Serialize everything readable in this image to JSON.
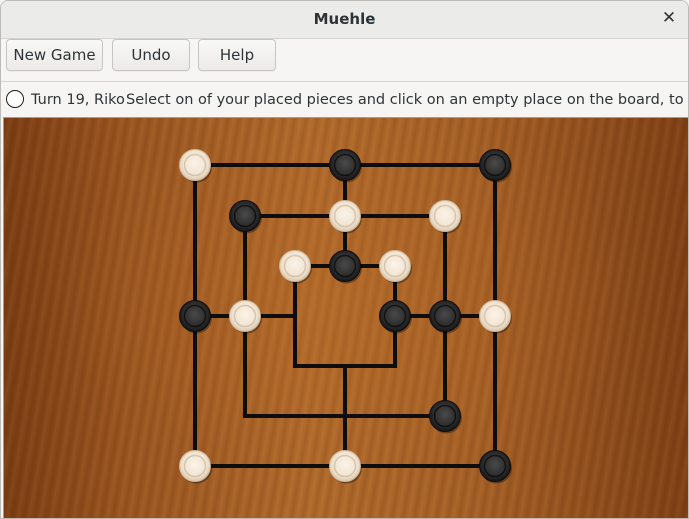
{
  "window": {
    "title": "Muehle",
    "close_icon": "close-icon"
  },
  "toolbar": {
    "new_game_label": "New Game",
    "undo_label": "Undo",
    "help_label": "Help"
  },
  "status": {
    "turn": "Turn 19, Riko",
    "message": "Select on of your placed pieces and click on an empty place on the board, to move it t",
    "indicator_color": "#ffffff"
  },
  "board": {
    "line_color": "#0d0d0d",
    "white_piece_color": "#f1e4d2",
    "black_piece_color": "#2b2b2b",
    "pieces": [
      {
        "point": "outer-top-left",
        "color": "white"
      },
      {
        "point": "outer-top-middle",
        "color": "black"
      },
      {
        "point": "outer-top-right",
        "color": "black"
      },
      {
        "point": "middle-top-left",
        "color": "black"
      },
      {
        "point": "middle-top-middle",
        "color": "white"
      },
      {
        "point": "middle-top-right",
        "color": "white"
      },
      {
        "point": "inner-top-left",
        "color": "white"
      },
      {
        "point": "inner-top-middle",
        "color": "black"
      },
      {
        "point": "inner-top-right",
        "color": "white"
      },
      {
        "point": "outer-middle-left",
        "color": "black"
      },
      {
        "point": "middle-middle-left",
        "color": "white"
      },
      {
        "point": "inner-middle-right",
        "color": "black"
      },
      {
        "point": "middle-middle-right",
        "color": "black"
      },
      {
        "point": "outer-middle-right",
        "color": "white"
      },
      {
        "point": "middle-bottom-right",
        "color": "black"
      },
      {
        "point": "outer-bottom-left",
        "color": "white"
      },
      {
        "point": "outer-bottom-middle",
        "color": "white"
      },
      {
        "point": "outer-bottom-right",
        "color": "black"
      }
    ]
  }
}
